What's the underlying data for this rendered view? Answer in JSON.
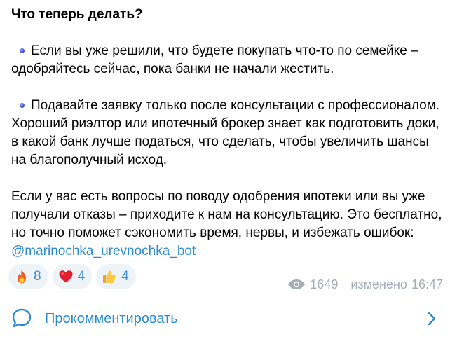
{
  "post": {
    "title": "Что теперь делать?",
    "bullet1_text": "Если вы уже решили, что будете покупать что-то по семейке – одобряйтесь сейчас, пока банки не начали жестить.",
    "bullet2_text": "Подавайте заявку только после консультации с профессионалом. Хороший риэлтор или ипотечный брокер знает как подготовить доки, в какой банк лучше податься, что сделать, чтобы увеличить шансы на благополучный исход.",
    "closing_text": "Если у вас есть вопросы по поводу одобрения ипотеки или вы уже получали отказы – приходите к нам на консультацию. Это бесплатно, но точно поможет сэкономить время, нервы, и избежать ошибок: ",
    "mention": "@marinochka_urevnochka_bot",
    "bullet_icon": "blue-diamond-emoji"
  },
  "reactions": [
    {
      "emoji": "fire-icon",
      "count": "8"
    },
    {
      "emoji": "heart-icon",
      "count": "4"
    },
    {
      "emoji": "thumbs-up-icon",
      "count": "4"
    }
  ],
  "meta": {
    "views": "1649",
    "edited_label": "изменено",
    "time": "16:47"
  },
  "comments": {
    "label": "Прокомментировать"
  },
  "colors": {
    "accent": "#2a8bd3",
    "reaction_bg": "#eef3f8",
    "meta": "#a3adb6"
  }
}
